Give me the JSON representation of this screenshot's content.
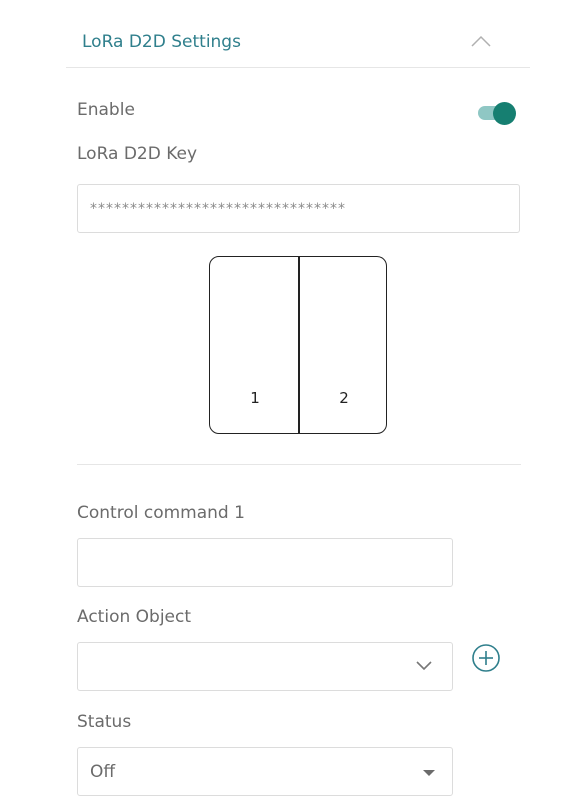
{
  "section": {
    "title": "LoRa D2D Settings",
    "collapse_icon": "chevron-up-icon"
  },
  "enable": {
    "label": "Enable",
    "state": "on",
    "accent_color": "#167f71"
  },
  "d2d_key": {
    "label": "LoRa D2D Key",
    "value": "********************************"
  },
  "switch_panel": {
    "buttons": [
      "1",
      "2"
    ]
  },
  "control_command": {
    "label": "Control command 1",
    "value": ""
  },
  "action_object": {
    "label": "Action Object",
    "value": "",
    "dropdown_icon": "chevron-down-icon",
    "add_icon": "plus-circle-icon"
  },
  "status": {
    "label": "Status",
    "value": "Off"
  },
  "colors": {
    "title": "#2f7f8c",
    "accent": "#167f71",
    "border": "#dcdcdc"
  }
}
